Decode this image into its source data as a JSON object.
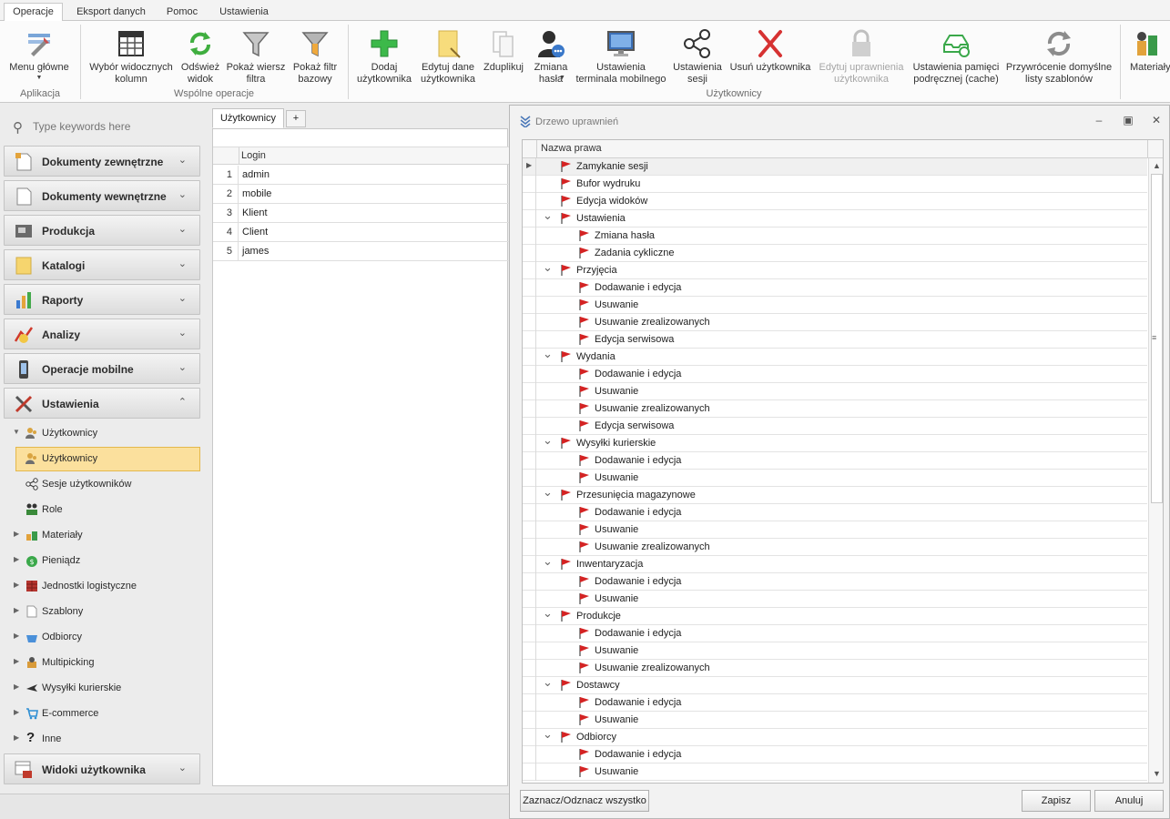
{
  "ribbon_tabs": [
    "Operacje",
    "Eksport danych",
    "Pomoc",
    "Ustawienia"
  ],
  "ribbon": {
    "groups": {
      "aplikacja": "Aplikacja",
      "wspolne": "Wspólne operacje",
      "uzytkownicy": "Użytkownicy"
    },
    "buttons": {
      "menu": "Menu główne",
      "wybor": "Wybór widocznych\nkolumn",
      "odswiez": "Odśwież\nwidok",
      "pokaz_wiersz": "Pokaż wiersz\nfiltra",
      "pokaz_filtr": "Pokaż filtr\nbazowy",
      "dodaj": "Dodaj\nużytkownika",
      "edytuj": "Edytuj dane\nużytkownika",
      "zduplikuj": "Zduplikuj",
      "zmiana_hasla": "Zmiana\nhasła",
      "ustawienia_terminala": "Ustawienia\nterminala mobilnego",
      "ustawienia_sesji": "Ustawienia\nsesji",
      "usun": "Usuń użytkownika",
      "edytuj_uprawnienia": "Edytuj uprawnienia\nużytkownika",
      "pamiec": "Ustawienia pamięci\npodręcznej (cache)",
      "przywrocenie": "Przywrócenie domyślne\nlisty szablonów",
      "materialy": "Materiały"
    }
  },
  "nav": {
    "search_placeholder": "Type keywords here",
    "groups": [
      "Dokumenty zewnętrzne",
      "Dokumenty wewnętrzne",
      "Produkcja",
      "Katalogi",
      "Raporty",
      "Analizy",
      "Operacje mobilne",
      "Ustawienia"
    ],
    "tree": [
      "Użytkownicy",
      "Użytkownicy",
      "Sesje użytkowników",
      "Role",
      "Materiały",
      "Pieniądz",
      "Jednostki logistyczne",
      "Szablony",
      "Odbiorcy",
      "Multipicking",
      "Wysyłki kurierskie",
      "E-commerce",
      "Inne"
    ],
    "bottom_group": "Widoki użytkownika"
  },
  "document": {
    "tab": "Użytkownicy",
    "add_tab": "+",
    "column": "Login",
    "rows": [
      {
        "n": "1",
        "login": "admin"
      },
      {
        "n": "2",
        "login": "mobile"
      },
      {
        "n": "3",
        "login": "Klient"
      },
      {
        "n": "4",
        "login": "Client"
      },
      {
        "n": "5",
        "login": "james"
      }
    ]
  },
  "dialog": {
    "title": "Drzewo uprawnień",
    "column": "Nazwa prawa",
    "rows": [
      {
        "label": "Zamykanie sesji",
        "level": 0,
        "expander": "current"
      },
      {
        "label": "Bufor wydruku",
        "level": 0,
        "expander": ""
      },
      {
        "label": "Edycja widoków",
        "level": 0,
        "expander": ""
      },
      {
        "label": "Ustawienia",
        "level": 0,
        "expander": "open"
      },
      {
        "label": "Zmiana hasła",
        "level": 1,
        "expander": ""
      },
      {
        "label": "Zadania cykliczne",
        "level": 1,
        "expander": ""
      },
      {
        "label": "Przyjęcia",
        "level": 0,
        "expander": "open"
      },
      {
        "label": "Dodawanie i edycja",
        "level": 1,
        "expander": ""
      },
      {
        "label": "Usuwanie",
        "level": 1,
        "expander": ""
      },
      {
        "label": "Usuwanie zrealizowanych",
        "level": 1,
        "expander": ""
      },
      {
        "label": "Edycja serwisowa",
        "level": 1,
        "expander": ""
      },
      {
        "label": "Wydania",
        "level": 0,
        "expander": "open"
      },
      {
        "label": "Dodawanie i edycja",
        "level": 1,
        "expander": ""
      },
      {
        "label": "Usuwanie",
        "level": 1,
        "expander": ""
      },
      {
        "label": "Usuwanie zrealizowanych",
        "level": 1,
        "expander": ""
      },
      {
        "label": "Edycja serwisowa",
        "level": 1,
        "expander": ""
      },
      {
        "label": "Wysyłki kurierskie",
        "level": 0,
        "expander": "open"
      },
      {
        "label": "Dodawanie i edycja",
        "level": 1,
        "expander": ""
      },
      {
        "label": "Usuwanie",
        "level": 1,
        "expander": ""
      },
      {
        "label": "Przesunięcia magazynowe",
        "level": 0,
        "expander": "open"
      },
      {
        "label": "Dodawanie i edycja",
        "level": 1,
        "expander": ""
      },
      {
        "label": "Usuwanie",
        "level": 1,
        "expander": ""
      },
      {
        "label": "Usuwanie zrealizowanych",
        "level": 1,
        "expander": ""
      },
      {
        "label": "Inwentaryzacja",
        "level": 0,
        "expander": "open"
      },
      {
        "label": "Dodawanie i edycja",
        "level": 1,
        "expander": ""
      },
      {
        "label": "Usuwanie",
        "level": 1,
        "expander": ""
      },
      {
        "label": "Produkcje",
        "level": 0,
        "expander": "open"
      },
      {
        "label": "Dodawanie i edycja",
        "level": 1,
        "expander": ""
      },
      {
        "label": "Usuwanie",
        "level": 1,
        "expander": ""
      },
      {
        "label": "Usuwanie zrealizowanych",
        "level": 1,
        "expander": ""
      },
      {
        "label": "Dostawcy",
        "level": 0,
        "expander": "open"
      },
      {
        "label": "Dodawanie i edycja",
        "level": 1,
        "expander": ""
      },
      {
        "label": "Usuwanie",
        "level": 1,
        "expander": ""
      },
      {
        "label": "Odbiorcy",
        "level": 0,
        "expander": "open"
      },
      {
        "label": "Dodawanie i edycja",
        "level": 1,
        "expander": ""
      },
      {
        "label": "Usuwanie",
        "level": 1,
        "expander": ""
      }
    ],
    "btn_toggle_all": "Zaznacz/Odznacz wszystko",
    "btn_save": "Zapisz",
    "btn_cancel": "Anuluj"
  },
  "colors": {
    "selection": "#fbe09d",
    "flag": "#d42323"
  }
}
